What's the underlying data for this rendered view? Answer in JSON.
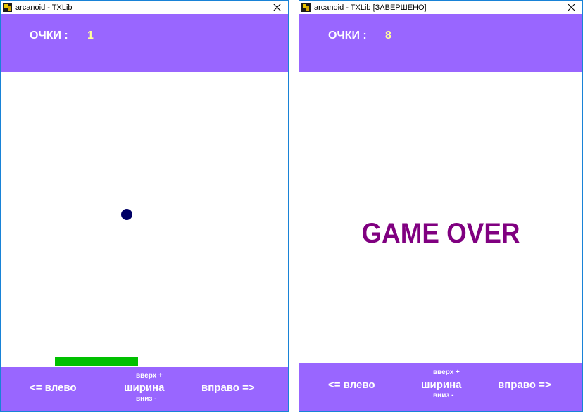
{
  "colors": {
    "bar_purple": "#9966ff",
    "score_value_yellow": "#ffff99",
    "ball_navy": "#000066",
    "paddle_green": "#00c000",
    "game_over_purple": "#800080",
    "window_border": "#1883d7"
  },
  "windows": [
    {
      "title": "arcanoid - TXLib",
      "score_label": "ОЧКИ :",
      "score_value": "1",
      "controls": {
        "left": "<=  влево",
        "up": "вверх +",
        "width": "ширина",
        "down": "вниз  -",
        "right": "вправо  =>"
      }
    },
    {
      "title": "arcanoid - TXLib [ЗАВЕРШЕНО]",
      "score_label": "ОЧКИ :",
      "score_value": "8",
      "game_over_text": "GAME OVER",
      "controls": {
        "left": "<=  влево",
        "up": "вверх +",
        "width": "ширина",
        "down": "вниз  -",
        "right": "вправо  =>"
      }
    }
  ],
  "icons": {
    "app_icon": "txlib-app-icon",
    "close_icon": "close-icon"
  }
}
